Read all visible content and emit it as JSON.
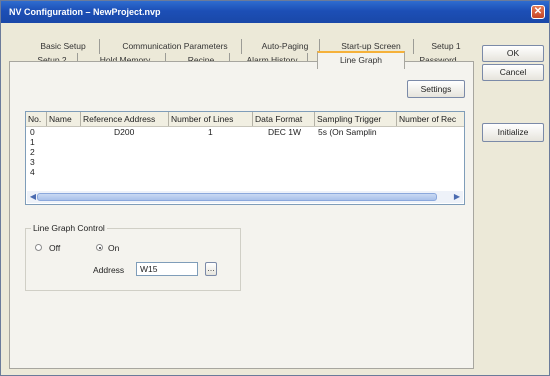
{
  "window": {
    "title": "NV Configuration – NewProject.nvp",
    "close_glyph": "✕"
  },
  "tabs": {
    "row1": [
      "Basic Setup",
      "Communication Parameters",
      "Auto-Paging",
      "Start-up Screen",
      "Setup 1"
    ],
    "row2": [
      "Setup 2",
      "Hold Memory",
      "Recipe",
      "Alarm History",
      "Line Graph",
      "Password"
    ],
    "active": "Line Graph"
  },
  "buttons": {
    "ok": "OK",
    "cancel": "Cancel",
    "initialize": "Initialize",
    "settings": "Settings"
  },
  "table": {
    "columns": [
      "No.",
      "Name",
      "Reference Address",
      "Number of Lines",
      "Data Format",
      "Sampling Trigger",
      "Number of Rec"
    ],
    "rows": [
      {
        "no": "0",
        "name": "",
        "reference_address": "D200",
        "number_of_lines": "1",
        "data_format": "DEC 1W",
        "sampling_trigger": "5s (On Samplin",
        "number_of_records": ""
      },
      {
        "no": "1"
      },
      {
        "no": "2"
      },
      {
        "no": "3"
      },
      {
        "no": "4"
      }
    ]
  },
  "line_graph_control": {
    "group_label": "Line Graph Control",
    "off_label": "Off",
    "on_label": "On",
    "selected": "On",
    "address_label": "Address",
    "address_value": "W15"
  },
  "icons": {
    "scroll_left": "◀",
    "scroll_right": "▶",
    "browse": "…"
  }
}
